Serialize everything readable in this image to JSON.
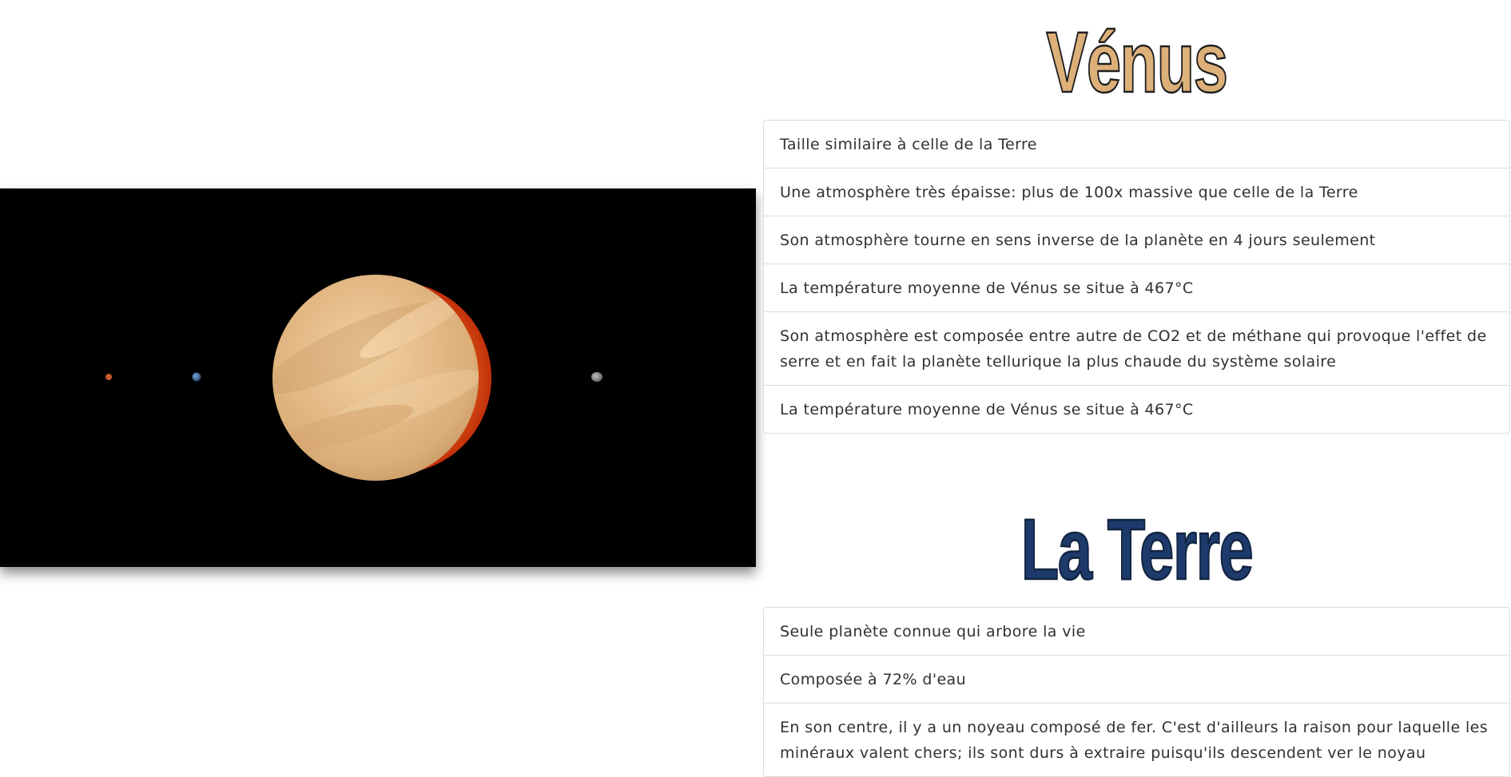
{
  "sections": [
    {
      "title": "Vénus",
      "title_color": "#ddb07a",
      "facts": [
        "Taille similaire à celle de la Terre",
        "Une atmosphère très épaisse: plus de 100x massive que celle de la Terre",
        "Son atmosphère tourne en sens inverse de la planète en 4 jours seulement",
        "La température moyenne de Vénus se situe à 467°C",
        "Son atmosphère est composée entre autre de CO2 et de méthane qui provoque l'effet de serre et en fait la planète tellurique la plus chaude du système solaire",
        "La température moyenne de Vénus se situe à 467°C"
      ]
    },
    {
      "title": "La Terre",
      "title_color": "#1d3a6b",
      "facts": [
        "Seule planète connue qui arbore la vie",
        "Composée à 72% d'eau",
        "En son centre, il y a un noyeau composé de fer. C'est d'ailleurs la raison pour laquelle les minéraux valent chers; ils sont durs à extraire puisqu'ils descendent ver le noyau"
      ]
    }
  ],
  "scene": {
    "background": "#000000",
    "main_planet_color": "#e8c08e",
    "sun_glow_color": "#e9571a"
  }
}
